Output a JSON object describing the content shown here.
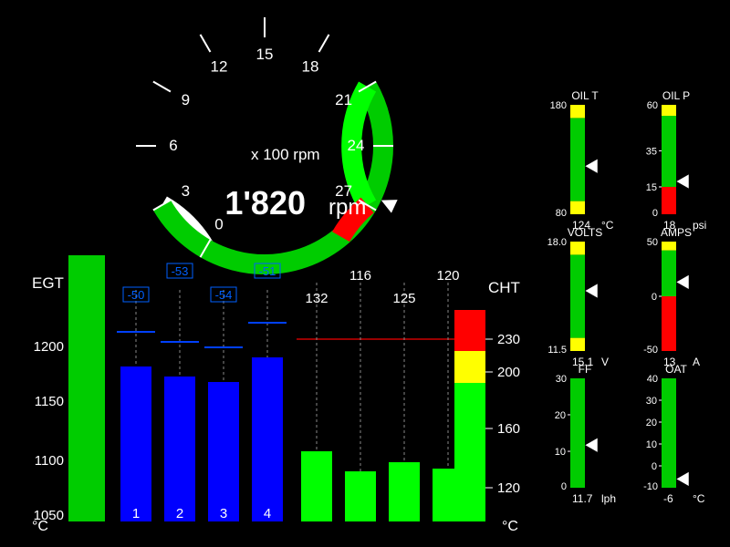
{
  "rpm": {
    "unit_text": "x 100 rpm",
    "value_text": "1'820",
    "unit_suffix": "rpm",
    "ticks": [
      "0",
      "3",
      "6",
      "9",
      "12",
      "15",
      "18",
      "21",
      "24",
      "27"
    ],
    "arc_segments": [
      {
        "from": 210,
        "to": 240,
        "color": "#ffffff"
      },
      {
        "from": 30,
        "to": 210,
        "color": "#00cc00"
      },
      {
        "from": -30,
        "to": 30,
        "color": "#00ff00"
      },
      {
        "from": -50,
        "to": -30,
        "color": "#ff0000"
      }
    ],
    "needle_angle": -25
  },
  "egt": {
    "label": "EGT",
    "unit": "°C",
    "ticks": [
      "1200",
      "1150",
      "1100",
      "1050"
    ],
    "lean": [
      "-50",
      "-53",
      "-54",
      "-51"
    ],
    "bars": [
      {
        "label": "1",
        "h": 170
      },
      {
        "label": "2",
        "h": 159
      },
      {
        "label": "3",
        "h": 153
      },
      {
        "label": "4",
        "h": 180
      }
    ],
    "ref_bar_h": 292
  },
  "cht": {
    "label": "CHT",
    "unit": "°C",
    "ticks": [
      "230",
      "200",
      "160",
      "120"
    ],
    "values": [
      "132",
      "116",
      "125",
      "120"
    ],
    "bars": [
      {
        "h": 77
      },
      {
        "h": 55
      },
      {
        "h": 65
      },
      {
        "h": 58
      }
    ]
  },
  "oilT": {
    "label": "OIL T",
    "min": "80",
    "max": "180",
    "value": "124",
    "unit": "°C",
    "bands": [
      {
        "from": 0,
        "to": 12,
        "color": "#ffff00"
      },
      {
        "from": 12,
        "to": 88,
        "color": "#00cc00"
      },
      {
        "from": 88,
        "to": 100,
        "color": "#ffff00"
      }
    ],
    "marker": 44
  },
  "oilP": {
    "label": "OIL P",
    "min": "0",
    "mid": "35",
    "max": "60",
    "extra_tick": "15",
    "value": "18",
    "unit": "psi",
    "bands": [
      {
        "from": 0,
        "to": 25,
        "color": "#ff0000"
      },
      {
        "from": 25,
        "to": 90,
        "color": "#00cc00"
      },
      {
        "from": 90,
        "to": 100,
        "color": "#ffff00"
      }
    ],
    "marker": 30
  },
  "volts": {
    "label": "VOLTS",
    "min": "11.5",
    "max": "18.0",
    "value": "15.1",
    "unit": "V",
    "bands": [
      {
        "from": 0,
        "to": 12,
        "color": "#ffff00"
      },
      {
        "from": 12,
        "to": 88,
        "color": "#00cc00"
      },
      {
        "from": 88,
        "to": 100,
        "color": "#ffff00"
      }
    ],
    "marker": 55
  },
  "amps": {
    "label": "AMPS",
    "min": "-50",
    "mid": "0",
    "max": "50",
    "value": "13",
    "unit": "A",
    "bands": [
      {
        "from": 0,
        "to": 50,
        "color": "#ff0000"
      },
      {
        "from": 50,
        "to": 92,
        "color": "#00cc00"
      },
      {
        "from": 92,
        "to": 100,
        "color": "#ffff00"
      }
    ],
    "marker": 63
  },
  "ff": {
    "label": "FF",
    "min": "0",
    "t1": "10",
    "t2": "20",
    "max": "30",
    "value": "11.7",
    "unit": "lph",
    "bands": [
      {
        "from": 0,
        "to": 100,
        "color": "#00cc00"
      }
    ],
    "marker": 39
  },
  "oat": {
    "label": "OAT",
    "min": "-10",
    "t1": "0",
    "t2": "10",
    "t3": "20",
    "t4": "30",
    "max": "40",
    "value": "-6",
    "unit": "°C",
    "bands": [
      {
        "from": 0,
        "to": 100,
        "color": "#00cc00"
      }
    ],
    "marker": 8
  },
  "chart_data": {
    "type": "dashboard",
    "rpm_value": 1820,
    "rpm_range": [
      0,
      2700
    ],
    "egt_unit": "°C",
    "egt_cylinders": [
      1170,
      1158,
      1152,
      1180
    ],
    "egt_lean_delta": [
      -50,
      -53,
      -54,
      -51
    ],
    "cht_unit": "°C",
    "cht_cylinders": [
      132,
      116,
      125,
      120
    ],
    "gauges": [
      {
        "name": "OIL T",
        "value": 124,
        "unit": "°C",
        "range": [
          80,
          180
        ]
      },
      {
        "name": "OIL P",
        "value": 18,
        "unit": "psi",
        "range": [
          0,
          60
        ]
      },
      {
        "name": "VOLTS",
        "value": 15.1,
        "unit": "V",
        "range": [
          11.5,
          18.0
        ]
      },
      {
        "name": "AMPS",
        "value": 13,
        "unit": "A",
        "range": [
          -50,
          50
        ]
      },
      {
        "name": "FF",
        "value": 11.7,
        "unit": "lph",
        "range": [
          0,
          30
        ]
      },
      {
        "name": "OAT",
        "value": -6,
        "unit": "°C",
        "range": [
          -10,
          40
        ]
      }
    ]
  }
}
